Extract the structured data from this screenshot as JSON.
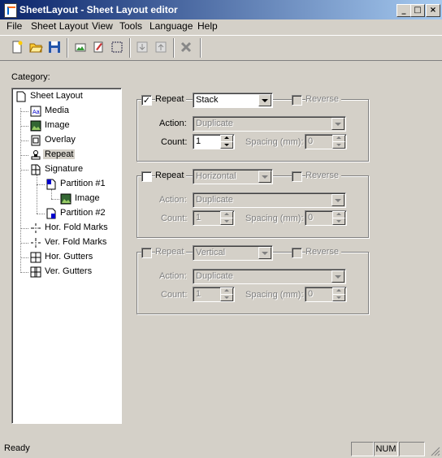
{
  "window": {
    "title": "SheetLayout - Sheet Layout editor"
  },
  "menu": [
    "File",
    "Sheet Layout",
    "View",
    "Tools",
    "Language",
    "Help"
  ],
  "category_label": "Category:",
  "tree": [
    {
      "label": "Sheet Layout",
      "icon": "page-icon"
    },
    {
      "label": "Media",
      "icon": "media-icon"
    },
    {
      "label": "Image",
      "icon": "image-icon"
    },
    {
      "label": "Overlay",
      "icon": "overlay-icon"
    },
    {
      "label": "Repeat",
      "icon": "stamp-icon",
      "selected": true
    },
    {
      "label": "Signature",
      "icon": "signature-icon"
    },
    {
      "label": "Partition #1",
      "icon": "partition-icon"
    },
    {
      "label": "Image",
      "icon": "image-icon"
    },
    {
      "label": "Partition #2",
      "icon": "partition-icon"
    },
    {
      "label": "Hor. Fold Marks",
      "icon": "fold-marks-icon"
    },
    {
      "label": "Ver. Fold Marks",
      "icon": "fold-marks-icon"
    },
    {
      "label": "Hor. Gutters",
      "icon": "gutters-icon"
    },
    {
      "label": "Ver. Gutters",
      "icon": "gutters-icon"
    }
  ],
  "groups": [
    {
      "repeat_label": "Repeat",
      "repeat_checked": true,
      "mode": "Stack",
      "reverse_label": "Reverse",
      "action_label": "Action:",
      "action": "Duplicate",
      "count_label": "Count:",
      "count": "1",
      "spacing_label": "Spacing (mm):",
      "spacing": "0"
    },
    {
      "repeat_label": "Repeat",
      "repeat_checked": false,
      "mode": "Horizontal",
      "reverse_label": "Reverse",
      "action_label": "Action:",
      "action": "Duplicate",
      "count_label": "Count:",
      "count": "1",
      "spacing_label": "Spacing (mm):",
      "spacing": "0"
    },
    {
      "repeat_label": "Repeat",
      "repeat_checked": false,
      "mode": "Vertical",
      "reverse_label": "Reverse",
      "action_label": "Action:",
      "action": "Duplicate",
      "count_label": "Count:",
      "count": "1",
      "spacing_label": "Spacing (mm):",
      "spacing": "0"
    }
  ],
  "status": {
    "text": "Ready",
    "num": "NUM"
  }
}
